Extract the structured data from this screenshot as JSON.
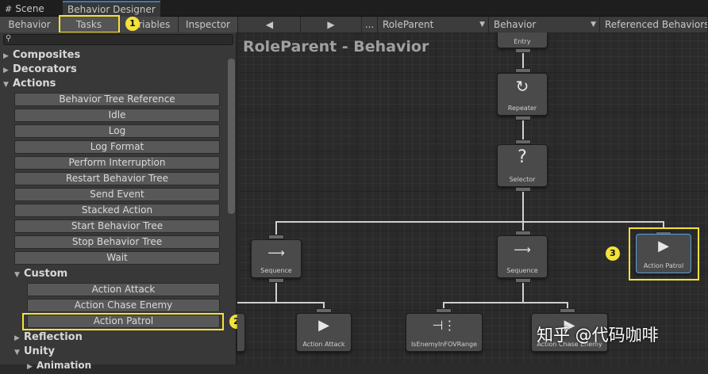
{
  "window_tabs": [
    "Scene",
    "Behavior Designer"
  ],
  "toolbar": {
    "tabs": [
      "Behavior",
      "Tasks",
      "Variables",
      "Inspector"
    ],
    "prev": "◀",
    "next": "▶",
    "more": "...",
    "dropdowns": [
      "RoleParent",
      "Behavior",
      "Referenced Behaviors"
    ]
  },
  "panel": {
    "categories": [
      "Composites",
      "Decorators",
      "Actions"
    ],
    "actions": [
      "Behavior Tree Reference",
      "Idle",
      "Log",
      "Log Format",
      "Perform Interruption",
      "Restart Behavior Tree",
      "Send Event",
      "Stacked Action",
      "Start Behavior Tree",
      "Stop Behavior Tree",
      "Wait"
    ],
    "custom_label": "Custom",
    "custom": [
      "Action Attack",
      "Action Chase Enemy",
      "Action Patrol"
    ],
    "more_categories": [
      "Reflection",
      "Unity",
      "Animation"
    ]
  },
  "graph": {
    "title": "RoleParent - Behavior",
    "nodes": {
      "entry": "Entry",
      "repeater": "Repeater",
      "selector": "Selector",
      "sequence_left": "Sequence",
      "sequence_mid": "Sequence",
      "action_patrol": "Action Patrol",
      "action_attack": "Action Attack",
      "is_enemy": "IsEnemyInFOVRange",
      "action_chase": "Action Chase Enemy"
    }
  },
  "annotations": [
    "1",
    "2",
    "3"
  ],
  "watermark": "知乎 @代码咖啡",
  "colors": {
    "highlight": "#f4e23b",
    "accent": "#3a79bb"
  }
}
